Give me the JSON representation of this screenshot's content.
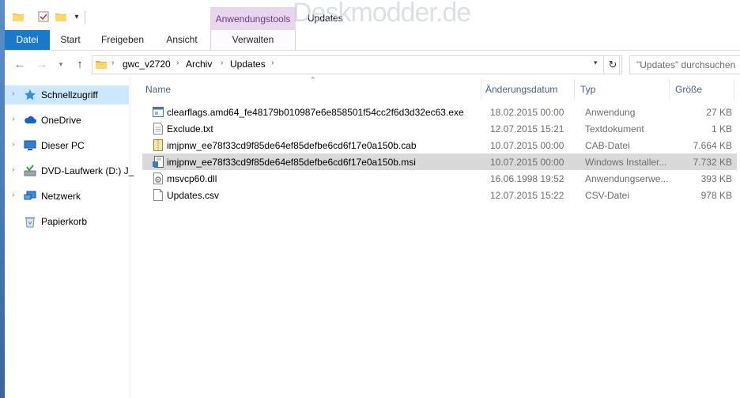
{
  "titlebar": {
    "context_tab": "Anwendungstools",
    "window_title": "Updates",
    "watermark": "Deskmodder.de"
  },
  "ribbon": {
    "tabs": [
      "Datei",
      "Start",
      "Freigeben",
      "Ansicht",
      "Verwalten"
    ]
  },
  "address": {
    "crumbs": [
      "gwc_v2720",
      "Archiv",
      "Updates"
    ],
    "search_placeholder": "\"Updates\" durchsuchen"
  },
  "sidebar": {
    "items": [
      {
        "label": "Schnellzugriff",
        "icon": "star-icon",
        "selected": true,
        "expandable": true
      },
      {
        "label": "OneDrive",
        "icon": "cloud-icon",
        "selected": false,
        "expandable": true
      },
      {
        "label": "Dieser PC",
        "icon": "computer-icon",
        "selected": false,
        "expandable": true
      },
      {
        "label": "DVD-Laufwerk (D:) J_",
        "icon": "dvd-drive-icon",
        "selected": false,
        "expandable": true
      },
      {
        "label": "Netzwerk",
        "icon": "network-icon",
        "selected": false,
        "expandable": true
      },
      {
        "label": "Papierkorb",
        "icon": "recycle-bin-icon",
        "selected": false,
        "expandable": false
      }
    ]
  },
  "columns": {
    "name": "Name",
    "date": "Änderungsdatum",
    "type": "Typ",
    "size": "Größe"
  },
  "files": [
    {
      "name": "clearflags.amd64_fe48179b010987e6e858501f54cc2f6d3d32ec63.exe",
      "date": "18.02.2015 00:00",
      "type": "Anwendung",
      "size": "27 KB",
      "icon": "exe-file-icon",
      "selected": false
    },
    {
      "name": "Exclude.txt",
      "date": "12.07.2015 15:21",
      "type": "Textdokument",
      "size": "1 KB",
      "icon": "text-file-icon",
      "selected": false
    },
    {
      "name": "imjpnw_ee78f33cd9f85de64ef85defbe6cd6f17e0a150b.cab",
      "date": "10.07.2015 00:00",
      "type": "CAB-Datei",
      "size": "7.664 KB",
      "icon": "cab-file-icon",
      "selected": false
    },
    {
      "name": "imjpnw_ee78f33cd9f85de64ef85defbe6cd6f17e0a150b.msi",
      "date": "10.07.2015 00:00",
      "type": "Windows Installer...",
      "size": "7.732 KB",
      "icon": "msi-file-icon",
      "selected": true
    },
    {
      "name": "msvcp60.dll",
      "date": "16.06.1998 19:52",
      "type": "Anwendungserwe...",
      "size": "393 KB",
      "icon": "dll-file-icon",
      "selected": false
    },
    {
      "name": "Updates.csv",
      "date": "12.07.2015 15:22",
      "type": "CSV-Datei",
      "size": "978 KB",
      "icon": "csv-file-icon",
      "selected": false
    }
  ]
}
